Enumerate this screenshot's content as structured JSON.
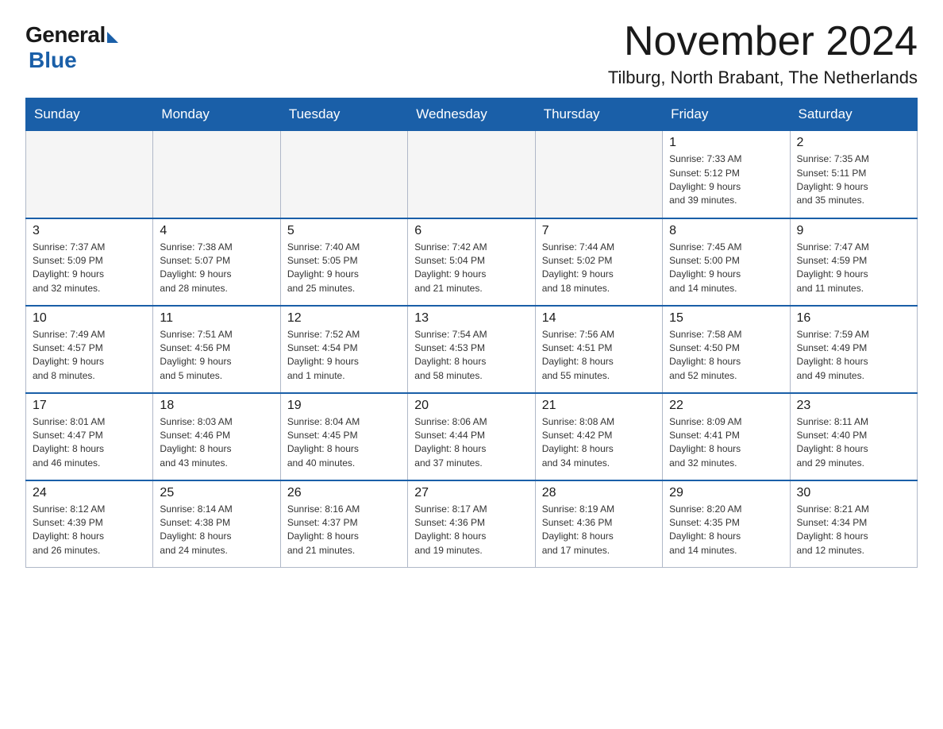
{
  "logo": {
    "general": "General",
    "blue": "Blue"
  },
  "title": "November 2024",
  "location": "Tilburg, North Brabant, The Netherlands",
  "weekdays": [
    "Sunday",
    "Monday",
    "Tuesday",
    "Wednesday",
    "Thursday",
    "Friday",
    "Saturday"
  ],
  "weeks": [
    [
      {
        "day": "",
        "info": ""
      },
      {
        "day": "",
        "info": ""
      },
      {
        "day": "",
        "info": ""
      },
      {
        "day": "",
        "info": ""
      },
      {
        "day": "",
        "info": ""
      },
      {
        "day": "1",
        "info": "Sunrise: 7:33 AM\nSunset: 5:12 PM\nDaylight: 9 hours\nand 39 minutes."
      },
      {
        "day": "2",
        "info": "Sunrise: 7:35 AM\nSunset: 5:11 PM\nDaylight: 9 hours\nand 35 minutes."
      }
    ],
    [
      {
        "day": "3",
        "info": "Sunrise: 7:37 AM\nSunset: 5:09 PM\nDaylight: 9 hours\nand 32 minutes."
      },
      {
        "day": "4",
        "info": "Sunrise: 7:38 AM\nSunset: 5:07 PM\nDaylight: 9 hours\nand 28 minutes."
      },
      {
        "day": "5",
        "info": "Sunrise: 7:40 AM\nSunset: 5:05 PM\nDaylight: 9 hours\nand 25 minutes."
      },
      {
        "day": "6",
        "info": "Sunrise: 7:42 AM\nSunset: 5:04 PM\nDaylight: 9 hours\nand 21 minutes."
      },
      {
        "day": "7",
        "info": "Sunrise: 7:44 AM\nSunset: 5:02 PM\nDaylight: 9 hours\nand 18 minutes."
      },
      {
        "day": "8",
        "info": "Sunrise: 7:45 AM\nSunset: 5:00 PM\nDaylight: 9 hours\nand 14 minutes."
      },
      {
        "day": "9",
        "info": "Sunrise: 7:47 AM\nSunset: 4:59 PM\nDaylight: 9 hours\nand 11 minutes."
      }
    ],
    [
      {
        "day": "10",
        "info": "Sunrise: 7:49 AM\nSunset: 4:57 PM\nDaylight: 9 hours\nand 8 minutes."
      },
      {
        "day": "11",
        "info": "Sunrise: 7:51 AM\nSunset: 4:56 PM\nDaylight: 9 hours\nand 5 minutes."
      },
      {
        "day": "12",
        "info": "Sunrise: 7:52 AM\nSunset: 4:54 PM\nDaylight: 9 hours\nand 1 minute."
      },
      {
        "day": "13",
        "info": "Sunrise: 7:54 AM\nSunset: 4:53 PM\nDaylight: 8 hours\nand 58 minutes."
      },
      {
        "day": "14",
        "info": "Sunrise: 7:56 AM\nSunset: 4:51 PM\nDaylight: 8 hours\nand 55 minutes."
      },
      {
        "day": "15",
        "info": "Sunrise: 7:58 AM\nSunset: 4:50 PM\nDaylight: 8 hours\nand 52 minutes."
      },
      {
        "day": "16",
        "info": "Sunrise: 7:59 AM\nSunset: 4:49 PM\nDaylight: 8 hours\nand 49 minutes."
      }
    ],
    [
      {
        "day": "17",
        "info": "Sunrise: 8:01 AM\nSunset: 4:47 PM\nDaylight: 8 hours\nand 46 minutes."
      },
      {
        "day": "18",
        "info": "Sunrise: 8:03 AM\nSunset: 4:46 PM\nDaylight: 8 hours\nand 43 minutes."
      },
      {
        "day": "19",
        "info": "Sunrise: 8:04 AM\nSunset: 4:45 PM\nDaylight: 8 hours\nand 40 minutes."
      },
      {
        "day": "20",
        "info": "Sunrise: 8:06 AM\nSunset: 4:44 PM\nDaylight: 8 hours\nand 37 minutes."
      },
      {
        "day": "21",
        "info": "Sunrise: 8:08 AM\nSunset: 4:42 PM\nDaylight: 8 hours\nand 34 minutes."
      },
      {
        "day": "22",
        "info": "Sunrise: 8:09 AM\nSunset: 4:41 PM\nDaylight: 8 hours\nand 32 minutes."
      },
      {
        "day": "23",
        "info": "Sunrise: 8:11 AM\nSunset: 4:40 PM\nDaylight: 8 hours\nand 29 minutes."
      }
    ],
    [
      {
        "day": "24",
        "info": "Sunrise: 8:12 AM\nSunset: 4:39 PM\nDaylight: 8 hours\nand 26 minutes."
      },
      {
        "day": "25",
        "info": "Sunrise: 8:14 AM\nSunset: 4:38 PM\nDaylight: 8 hours\nand 24 minutes."
      },
      {
        "day": "26",
        "info": "Sunrise: 8:16 AM\nSunset: 4:37 PM\nDaylight: 8 hours\nand 21 minutes."
      },
      {
        "day": "27",
        "info": "Sunrise: 8:17 AM\nSunset: 4:36 PM\nDaylight: 8 hours\nand 19 minutes."
      },
      {
        "day": "28",
        "info": "Sunrise: 8:19 AM\nSunset: 4:36 PM\nDaylight: 8 hours\nand 17 minutes."
      },
      {
        "day": "29",
        "info": "Sunrise: 8:20 AM\nSunset: 4:35 PM\nDaylight: 8 hours\nand 14 minutes."
      },
      {
        "day": "30",
        "info": "Sunrise: 8:21 AM\nSunset: 4:34 PM\nDaylight: 8 hours\nand 12 minutes."
      }
    ]
  ]
}
